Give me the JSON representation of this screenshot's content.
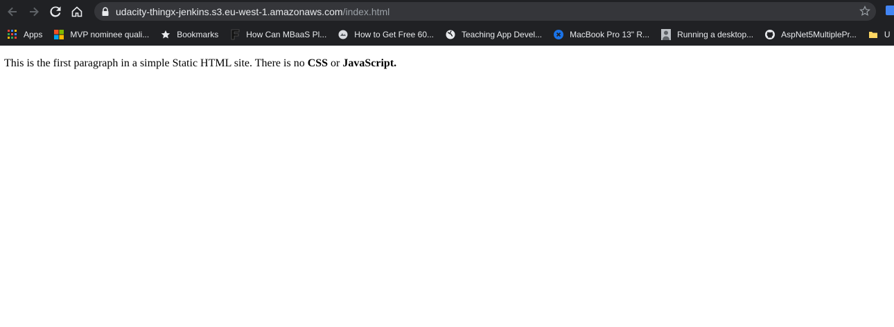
{
  "browser": {
    "url": {
      "host": "udacity-thingx-jenkins.s3.eu-west-1.amazonaws.com",
      "path": "/index.html"
    },
    "bookmarks": [
      {
        "label": "Apps",
        "icon": "apps-grid-icon"
      },
      {
        "label": "MVP nominee quali...",
        "icon": "microsoft-logo-icon"
      },
      {
        "label": "Bookmarks",
        "icon": "star-icon"
      },
      {
        "label": "How Can MBaaS Pl...",
        "icon": "f-logo-icon"
      },
      {
        "label": "How to Get Free 60...",
        "icon": "site-icon"
      },
      {
        "label": "Teaching App Devel...",
        "icon": "globe-icon"
      },
      {
        "label": "MacBook Pro 13\" R...",
        "icon": "blue-x-icon"
      },
      {
        "label": "Running a desktop...",
        "icon": "avatar-icon"
      },
      {
        "label": "AspNet5MultiplePr...",
        "icon": "github-icon"
      },
      {
        "label": "U",
        "icon": "folder-icon"
      }
    ]
  },
  "page": {
    "paragraph": {
      "text_before": "This is the first paragraph in a simple Static HTML site. There is no ",
      "bold_1": "CSS",
      "middle": " or ",
      "bold_2": "JavaScript."
    }
  },
  "colors": {
    "chrome_dark": "#202124",
    "omnibox_bg": "#35363a",
    "text_light": "#e8eaed",
    "text_muted": "#9aa0a6"
  }
}
